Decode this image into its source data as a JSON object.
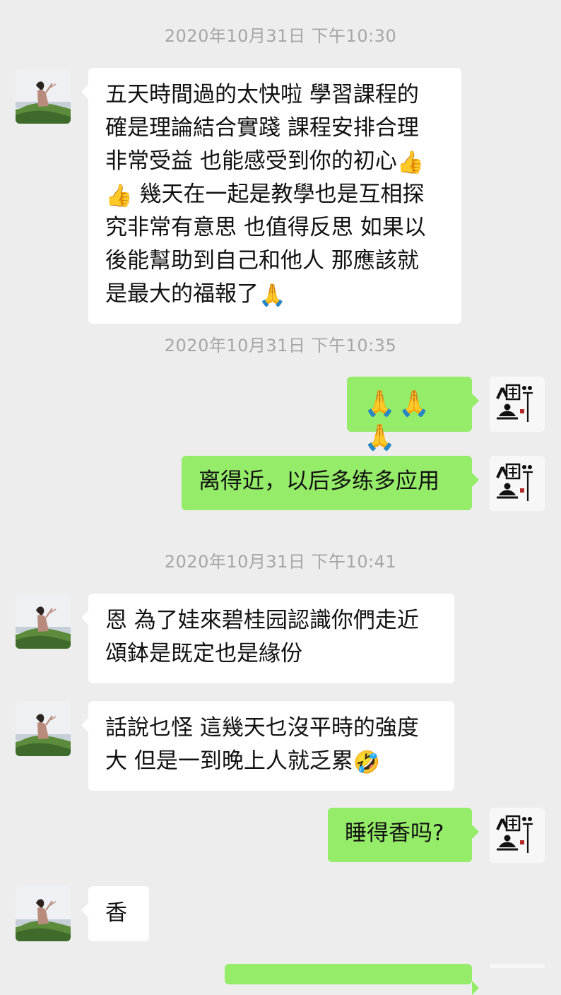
{
  "timestamps": [
    "2020年10月31日 下午10:30",
    "2020年10月31日 下午10:35",
    "2020年10月31日 下午10:41"
  ],
  "messages": [
    {
      "lines": [
        "五天時間過的太快啦 學習課程的",
        "確是理論結合實踐 課程安排合理",
        "非常受益 也能感受到你的初心",
        " 幾天在一起是教學也是互相探",
        "究非常有意思 也值得反思 如果以",
        "後能幫助到自己和他人 那應該就",
        "是最大的福報了"
      ],
      "icons": [
        "thumbs-up-icon",
        "thumbs-up-icon",
        "pray-icon"
      ]
    },
    {
      "icons": [
        "pray-icon",
        "pray-icon",
        "pray-icon"
      ]
    },
    {
      "text": "离得近，以后多练多应用"
    },
    {
      "lines": [
        "恩 為了娃來碧桂园認識你們走近",
        "頌鉢是既定也是緣份"
      ]
    },
    {
      "lines": [
        "話說乜怪 這幾天乜沒平時的強度",
        "大 但是一到晚上人就乏累"
      ],
      "icons": [
        "laughing-tears-icon"
      ]
    },
    {
      "text": "睡得香吗?"
    },
    {
      "text": "香"
    }
  ],
  "emoji": {
    "thumbs-up": "👍",
    "pray": "🙏",
    "laugh": "🤣"
  },
  "colors": {
    "background": "#ededed",
    "incoming_bubble": "#ffffff",
    "outgoing_bubble": "#95ec69",
    "timestamp": "#a6a6a6",
    "text": "#111111"
  }
}
